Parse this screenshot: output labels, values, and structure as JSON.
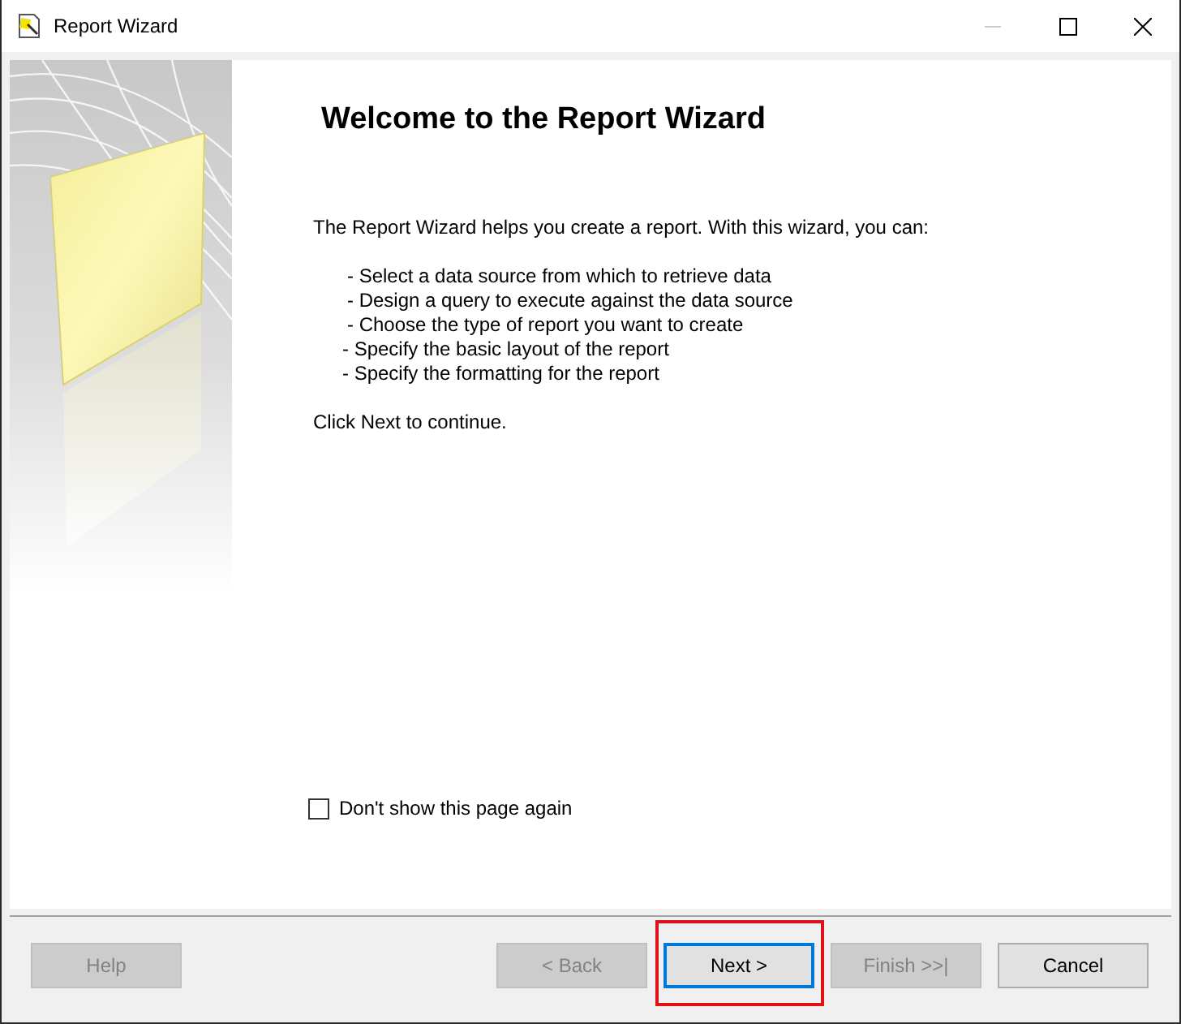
{
  "window": {
    "title": "Report Wizard",
    "controls": [
      {
        "kind": "minimize",
        "disabled": true
      },
      {
        "kind": "maximize",
        "disabled": false
      },
      {
        "kind": "close",
        "disabled": false
      }
    ]
  },
  "page": {
    "heading": "Welcome to the Report Wizard",
    "intro": "The Report Wizard helps you create a report. With this wizard, you can:",
    "bullets": [
      "- Select a data source from which to retrieve data",
      "- Design a query to execute against the data source",
      "- Choose the type of report you want to create",
      "- Specify the basic layout of the report",
      "- Specify the formatting for the report"
    ],
    "closing": "Click Next to continue.",
    "dont_show_again": {
      "label": "Don't show this page again",
      "checked": false
    }
  },
  "left_buttons": [
    {
      "label": "Help",
      "disabled": true,
      "default": false,
      "highlighted": false
    }
  ],
  "right_buttons": [
    {
      "label": "< Back",
      "disabled": true,
      "default": false,
      "highlighted": false
    },
    {
      "label": "Next >",
      "disabled": false,
      "default": true,
      "highlighted": true
    },
    {
      "label": "Finish >>|",
      "disabled": true,
      "default": false,
      "highlighted": false
    },
    {
      "label": "Cancel",
      "disabled": false,
      "default": false,
      "highlighted": false
    }
  ]
}
